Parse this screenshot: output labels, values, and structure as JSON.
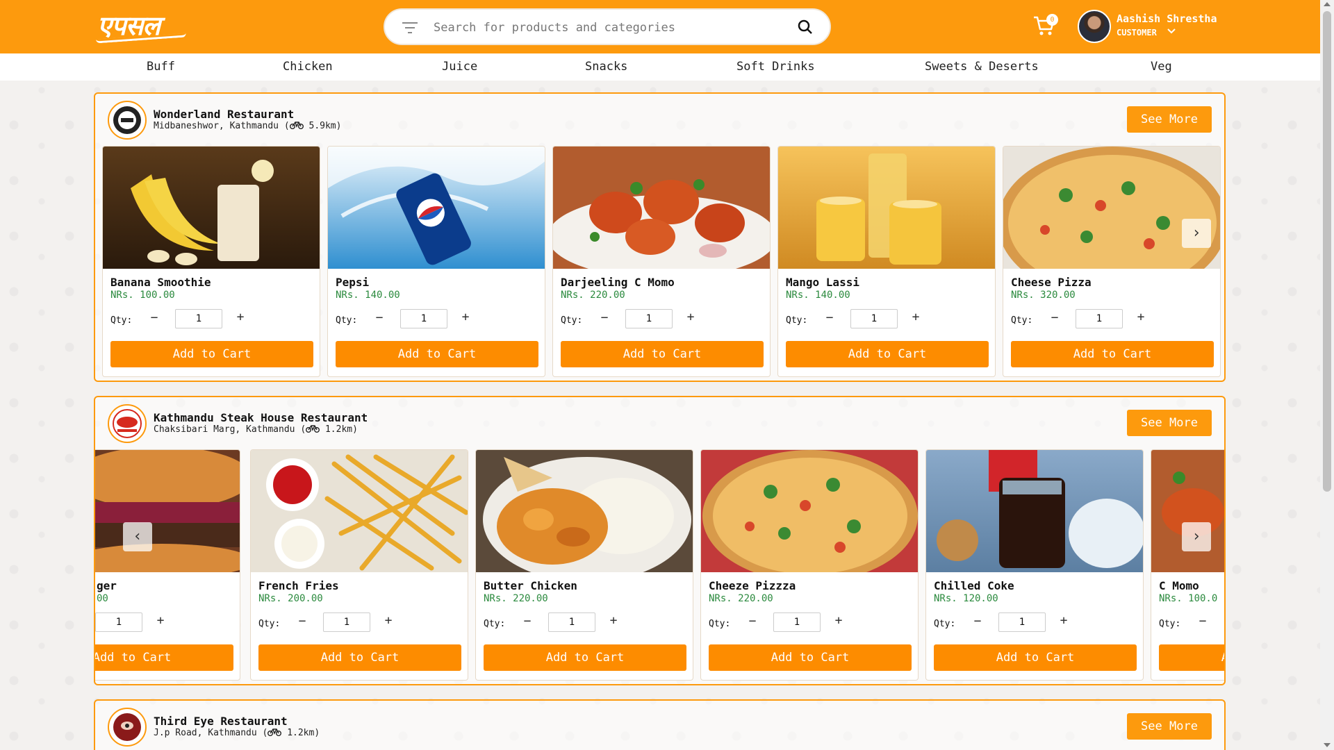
{
  "header": {
    "logo_text": "ePasal",
    "search_placeholder": "Search for products and categories",
    "cart_count": "0",
    "user_name": "Aashish Shrestha",
    "user_role": "CUSTOMER"
  },
  "categories": [
    "Buff",
    "Chicken",
    "Juice",
    "Snacks",
    "Soft Drinks",
    "Sweets & Deserts",
    "Veg"
  ],
  "labels": {
    "see_more": "See More",
    "qty": "Qty:",
    "add_to_cart": "Add to Cart",
    "qty_value": "1"
  },
  "restaurants": [
    {
      "name": "Wonderland Restaurant",
      "address": "Midbaneshwor, Kathmandu",
      "distance": "5.9km",
      "products": [
        {
          "name": "Banana Smoothie",
          "price": "NRs. 100.00",
          "image": "banana-smoothie"
        },
        {
          "name": "Pepsi",
          "price": "NRs. 140.00",
          "image": "pepsi"
        },
        {
          "name": "Darjeeling C Momo",
          "price": "NRs. 220.00",
          "image": "c-momo"
        },
        {
          "name": "Mango Lassi",
          "price": "NRs. 140.00",
          "image": "mango-lassi"
        },
        {
          "name": "Cheese Pizza",
          "price": "NRs. 320.00",
          "image": "pizza"
        }
      ]
    },
    {
      "name": "Kathmandu Steak House Restaurant",
      "address": "Chaksibari Marg, Kathmandu",
      "distance": "1.2km",
      "products": [
        {
          "name": "ger",
          "price": "00",
          "image": "burger"
        },
        {
          "name": "French Fries",
          "price": "NRs. 200.00",
          "image": "fries"
        },
        {
          "name": "Butter Chicken",
          "price": "NRs. 220.00",
          "image": "butter-chicken"
        },
        {
          "name": "Cheeze Pizzza",
          "price": "NRs. 220.00",
          "image": "pizza"
        },
        {
          "name": "Chilled Coke",
          "price": "NRs. 120.00",
          "image": "coke"
        },
        {
          "name": "C Momo",
          "price": "NRs. 100.0",
          "image": "c-momo"
        }
      ]
    },
    {
      "name": "Third Eye Restaurant",
      "address": "J.p Road, Kathmandu",
      "distance": "1.2km",
      "products": []
    }
  ],
  "colors": {
    "brand": "#fd9a0d",
    "price": "#2b8a3e"
  }
}
